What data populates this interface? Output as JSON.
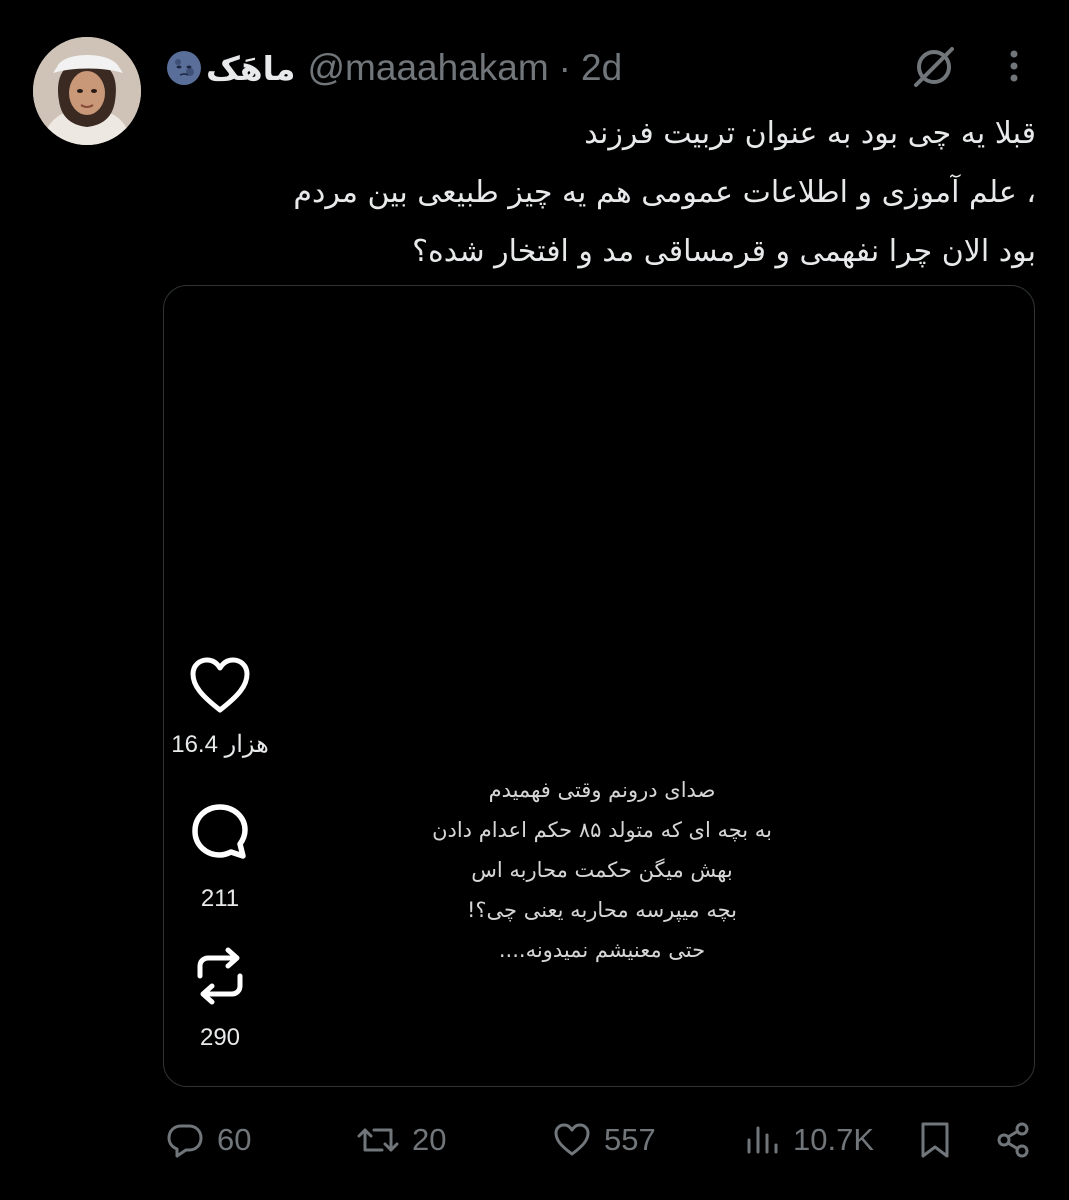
{
  "tweet": {
    "display_name": "ماهَک",
    "handle": "@maaahakam",
    "separator": "·",
    "time": "2d",
    "text_lines": [
      "قبلا یه چی بود به عنوان تربیت فرزند",
      "، علم آموزی و اطلاعات عمومی هم یه چیز طبیعی بین مردم",
      "بود الان چرا نفهمی و قرمساقی مد  و افتخار شده؟"
    ]
  },
  "media": {
    "quote_lines": [
      "صدای درونم وقتی فهمیدم",
      "به بچه ای که متولد ۸۵ حکم اعدام دادن",
      "بهش میگن حکمت محاربه اس",
      "بچه میپرسه محاربه یعنی چی؟!",
      "حتی معنیشم نمیدونه...."
    ],
    "side_actions": {
      "likes": "16.4 هزار",
      "comments": "211",
      "reposts": "290"
    }
  },
  "actions": {
    "replies": "60",
    "reposts": "20",
    "likes": "557",
    "views": "10.7K"
  },
  "colors": {
    "background": "#000000",
    "text": "#e7e9ea",
    "muted": "#71767b",
    "border": "#2f3336"
  }
}
